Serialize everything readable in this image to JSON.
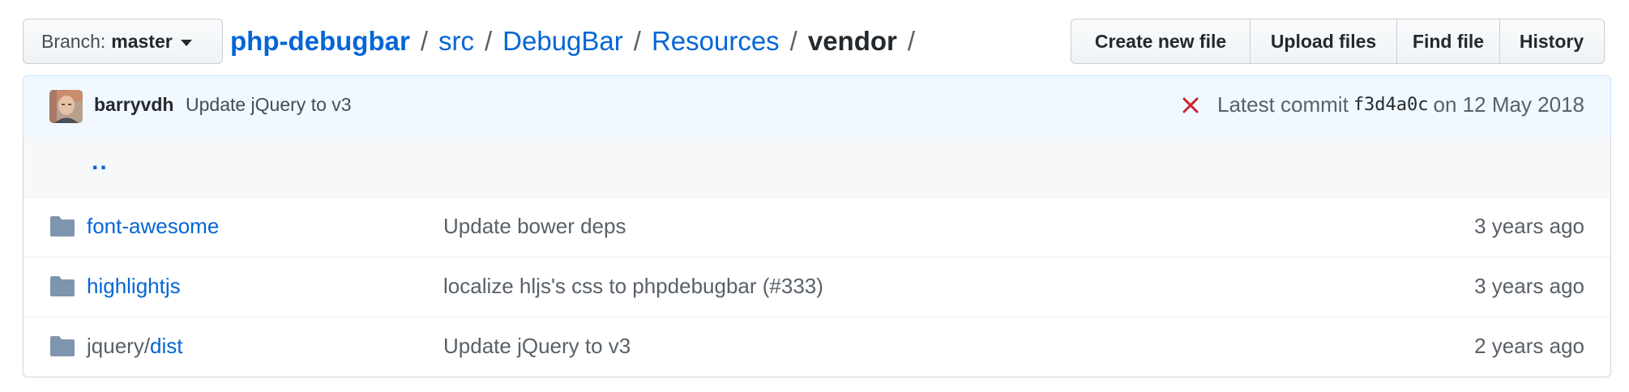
{
  "branch": {
    "prefix": "Branch:",
    "name": "master"
  },
  "breadcrumb": {
    "root": "php-debugbar",
    "segments": [
      "src",
      "DebugBar",
      "Resources"
    ],
    "current": "vendor",
    "separator": "/"
  },
  "actions": [
    "Create new file",
    "Upload files",
    "Find file",
    "History"
  ],
  "commit": {
    "author": "barryvdh",
    "message": "Update jQuery to v3",
    "status": "failure",
    "latest_label": "Latest commit",
    "sha": "f3d4a0c",
    "date": "on 12 May 2018"
  },
  "up_link": "..",
  "files": [
    {
      "icon": "folder-icon",
      "name": "font-awesome",
      "dir_prefix": "",
      "message": "Update bower deps",
      "age": "3 years ago"
    },
    {
      "icon": "folder-icon",
      "name": "highlightjs",
      "dir_prefix": "",
      "message": "localize hljs's css to phpdebugbar (#333)",
      "age": "3 years ago"
    },
    {
      "icon": "folder-icon",
      "name": "dist",
      "dir_prefix": "jquery/",
      "message": "Update jQuery to v3",
      "age": "2 years ago"
    }
  ],
  "colors": {
    "link": "#0366d6",
    "failure": "#cb2431",
    "folder": "#79b8ff",
    "commit_bg": "#f1f8ff"
  }
}
